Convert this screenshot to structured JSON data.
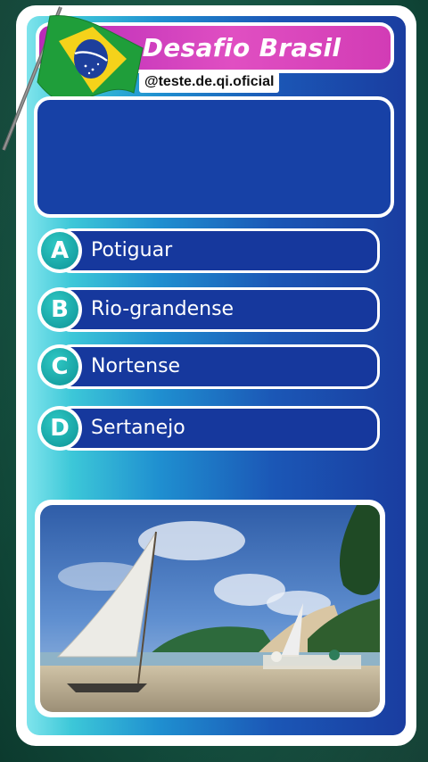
{
  "header": {
    "title": "Desafio Brasil",
    "handle": "@teste.de.qi.oficial"
  },
  "question": {
    "text": ""
  },
  "options": [
    {
      "letter": "A",
      "label": "Potiguar"
    },
    {
      "letter": "B",
      "label": "Rio-grandense"
    },
    {
      "letter": "C",
      "label": "Nortense"
    },
    {
      "letter": "D",
      "label": "Sertanejo"
    }
  ],
  "colors": {
    "title_bar": "#d23cb5",
    "option_fill": "#16389d",
    "letter_badge": "#17a3a4",
    "flag_green": "#1f9e3a",
    "flag_yellow": "#f5d21a",
    "flag_blue": "#1d3f9c"
  },
  "icons": {
    "flag": "brazil-flag-icon",
    "photo": "beach-sailboat-photo"
  }
}
